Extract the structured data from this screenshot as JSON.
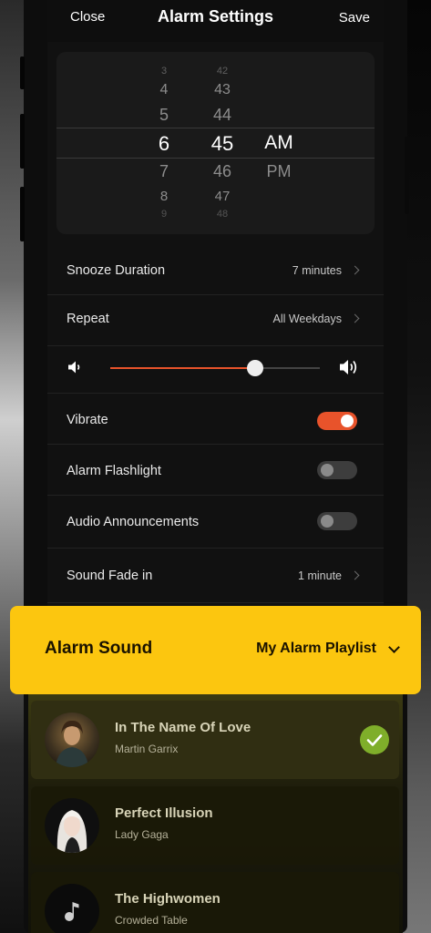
{
  "header": {
    "close": "Close",
    "title": "Alarm Settings",
    "save": "Save"
  },
  "picker": {
    "hours": [
      "3",
      "4",
      "5",
      "6",
      "7",
      "8",
      "9"
    ],
    "minutes": [
      "42",
      "43",
      "44",
      "45",
      "46",
      "47",
      "48"
    ],
    "periods": [
      "AM",
      "PM"
    ],
    "selected": {
      "hour": "6",
      "minute": "45",
      "period": "AM"
    }
  },
  "settings": {
    "snooze": {
      "label": "Snooze Duration",
      "value": "7 minutes"
    },
    "repeat": {
      "label": "Repeat",
      "value": "All Weekdays"
    },
    "volume": {
      "level": 0.69
    },
    "vibrate": {
      "label": "Vibrate",
      "on": true
    },
    "flashlight": {
      "label": "Alarm Flashlight",
      "on": false
    },
    "announcements": {
      "label": "Audio Announcements",
      "on": false
    },
    "fade": {
      "label": "Sound Fade in",
      "value": "1 minute"
    }
  },
  "sound": {
    "title": "Alarm Sound",
    "selected": "My Alarm Playlist"
  },
  "songs": [
    {
      "title": "In The Name Of Love",
      "artist": "Martin Garrix",
      "selected": true
    },
    {
      "title": "Perfect Illusion",
      "artist": "Lady Gaga",
      "selected": false
    },
    {
      "title": "The Highwomen",
      "artist": "Crowded Table",
      "selected": false
    }
  ],
  "colors": {
    "accent": "#e8532b",
    "sound_card": "#fcc60f",
    "check": "#7fae2a"
  },
  "icons": [
    "speaker-low-icon",
    "speaker-high-icon",
    "chevron-right-icon",
    "chevron-down-icon",
    "check-icon",
    "music-note-icon"
  ]
}
